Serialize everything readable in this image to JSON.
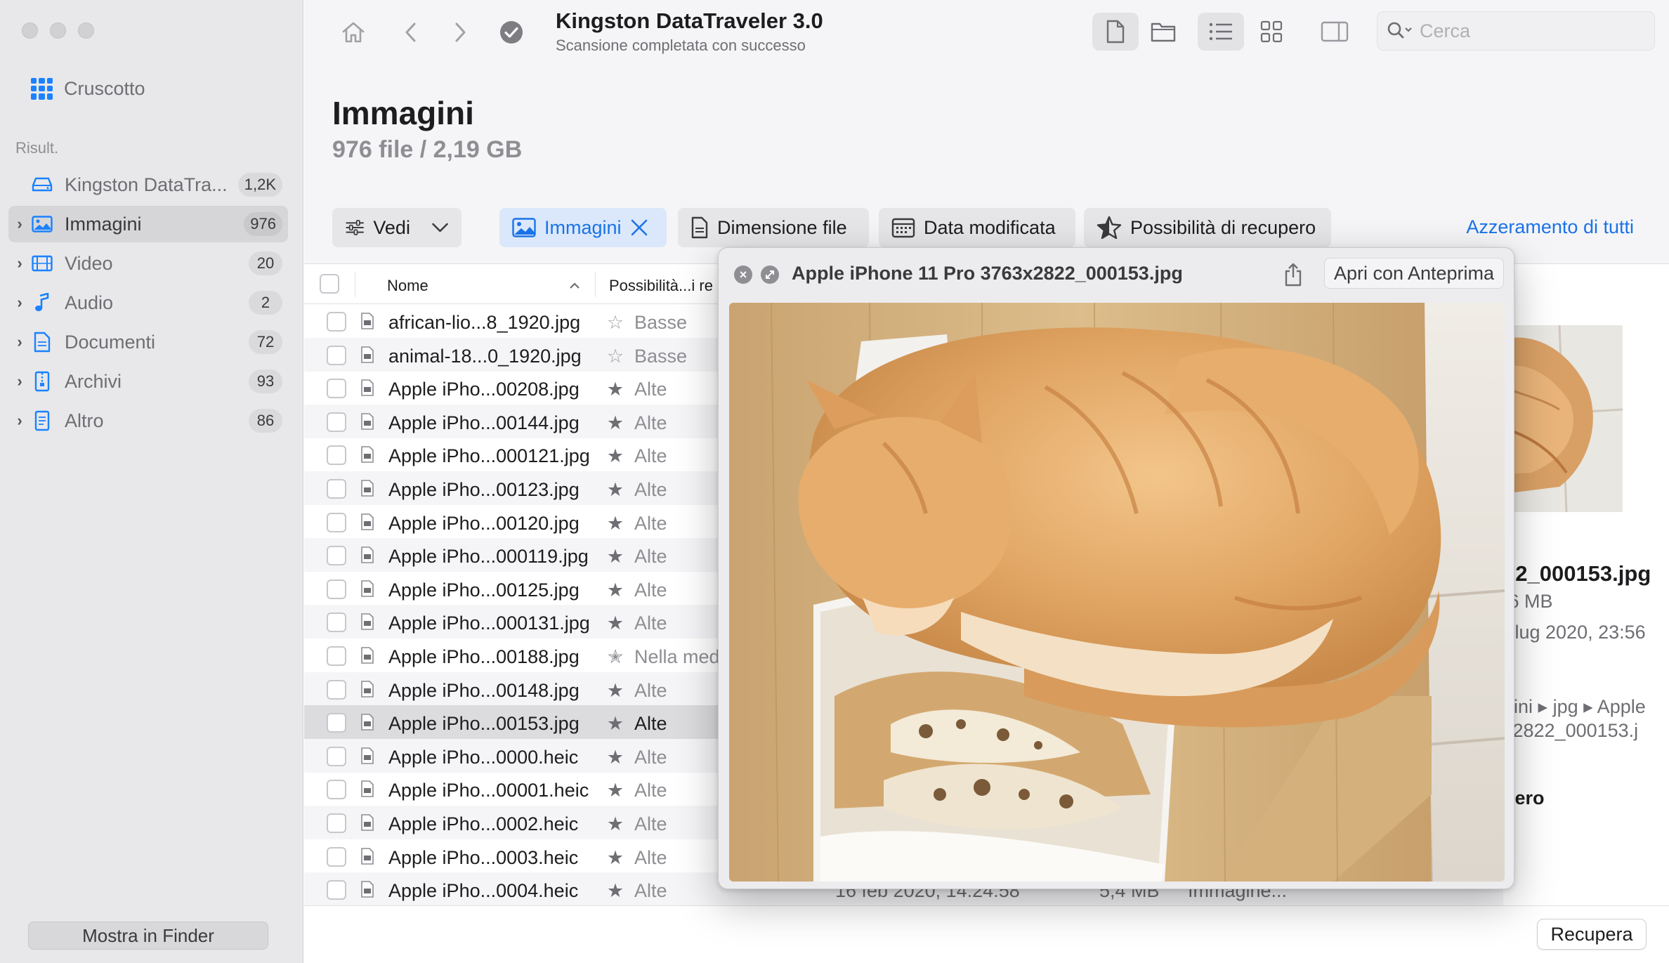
{
  "window": {
    "title": "Kingston DataTraveler 3.0",
    "subtitle": "Scansione completata con successo"
  },
  "search": {
    "placeholder": "Cerca"
  },
  "sidebar": {
    "dashboard_label": "Cruscotto",
    "results_label": "Risult.",
    "items": [
      {
        "label": "Kingston DataTra...",
        "count": "1,2K",
        "icon": "drive-icon",
        "expandable": false
      },
      {
        "label": "Immagini",
        "count": "976",
        "icon": "image-icon",
        "expandable": true,
        "active": true
      },
      {
        "label": "Video",
        "count": "20",
        "icon": "film-icon",
        "expandable": true
      },
      {
        "label": "Audio",
        "count": "2",
        "icon": "music-note-icon",
        "expandable": true
      },
      {
        "label": "Documenti",
        "count": "72",
        "icon": "document-icon",
        "expandable": true
      },
      {
        "label": "Archivi",
        "count": "93",
        "icon": "archive-icon",
        "expandable": true
      },
      {
        "label": "Altro",
        "count": "86",
        "icon": "other-file-icon",
        "expandable": true
      }
    ],
    "show_in_finder": "Mostra in Finder"
  },
  "header": {
    "title": "Immagini",
    "stats": "976 file / 2,19 GB",
    "filters": {
      "view_label": "Vedi",
      "images_label": "Immagini",
      "file_size_label": "Dimensione file",
      "date_modified_label": "Data modificata",
      "recovery_chances_label": "Possibilità di recupero",
      "reset_all_label": "Azzeramento di tutti"
    }
  },
  "table": {
    "columns": {
      "name": "Nome",
      "recovery": "Possibilità...i re"
    },
    "rows": [
      {
        "name": "african-lio...8_1920.jpg",
        "rating": "empty",
        "recovery": "Basse"
      },
      {
        "name": "animal-18...0_1920.jpg",
        "rating": "empty",
        "recovery": "Basse"
      },
      {
        "name": "Apple iPho...00208.jpg",
        "rating": "filled",
        "recovery": "Alte"
      },
      {
        "name": "Apple iPho...00144.jpg",
        "rating": "filled",
        "recovery": "Alte"
      },
      {
        "name": "Apple iPho...000121.jpg",
        "rating": "filled",
        "recovery": "Alte"
      },
      {
        "name": "Apple iPho...00123.jpg",
        "rating": "filled",
        "recovery": "Alte"
      },
      {
        "name": "Apple iPho...00120.jpg",
        "rating": "filled",
        "recovery": "Alte"
      },
      {
        "name": "Apple iPho...000119.jpg",
        "rating": "filled",
        "recovery": "Alte"
      },
      {
        "name": "Apple iPho...00125.jpg",
        "rating": "filled",
        "recovery": "Alte"
      },
      {
        "name": "Apple iPho...000131.jpg",
        "rating": "filled",
        "recovery": "Alte"
      },
      {
        "name": "Apple iPho...00188.jpg",
        "rating": "half",
        "recovery": "Nella med"
      },
      {
        "name": "Apple iPho...00148.jpg",
        "rating": "filled",
        "recovery": "Alte"
      },
      {
        "name": "Apple iPho...00153.jpg",
        "rating": "filled",
        "recovery": "Alte",
        "selected": true
      },
      {
        "name": "Apple iPho...0000.heic",
        "rating": "filled",
        "recovery": "Alte"
      },
      {
        "name": "Apple iPho...00001.heic",
        "rating": "filled",
        "recovery": "Alte"
      },
      {
        "name": "Apple iPho...0002.heic",
        "rating": "filled",
        "recovery": "Alte"
      },
      {
        "name": "Apple iPho...0003.heic",
        "rating": "filled",
        "recovery": "Alte"
      },
      {
        "name": "Apple iPho...0004.heic",
        "rating": "filled",
        "recovery": "Alte"
      }
    ],
    "last_row_partial": {
      "date": "16 feb 2020, 14:24:58",
      "size": "5,4 MB",
      "kind": "Immagine..."
    }
  },
  "details": {
    "filename_fragment": "22_000153.jpg",
    "size_fragment": ",6 MB",
    "date_fragment": ") lug 2020, 23:56",
    "path_line1": "gini ▸ jpg ▸ Apple",
    "path_line2": "x2822_000153.j",
    "recovery_fragment": "pero"
  },
  "quicklook": {
    "title": "Apple iPhone 11 Pro 3763x2822_000153.jpg",
    "open_with_label": "Apri con Anteprima"
  },
  "footer": {
    "recover_label": "Recupera"
  },
  "colors": {
    "accent": "#1a73e8",
    "sidebar_bg": "#e8e8ea",
    "selected_row": "#dcdcdf"
  }
}
